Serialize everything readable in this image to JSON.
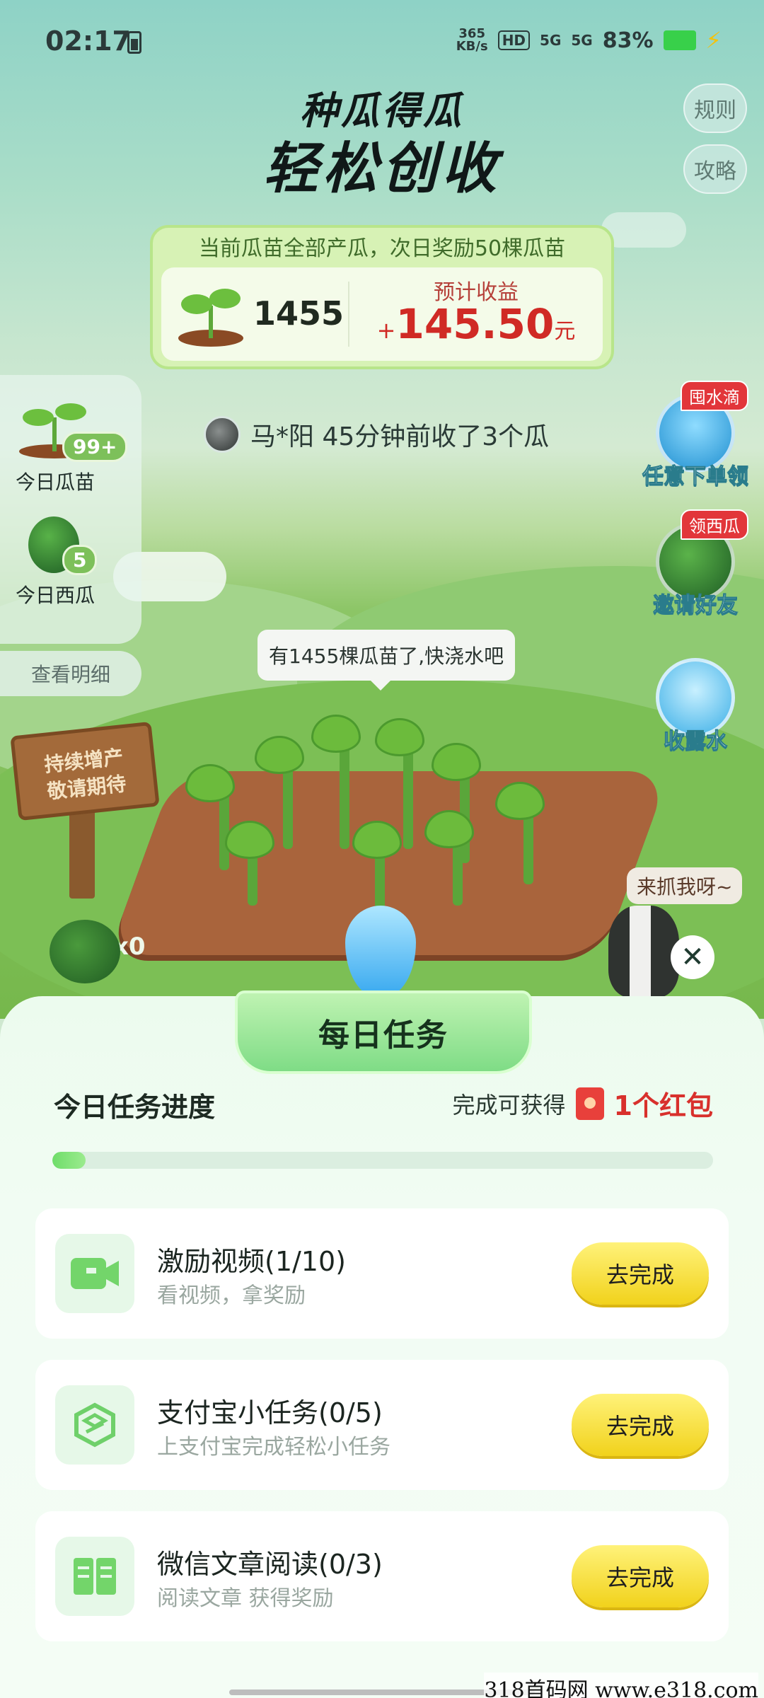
{
  "status": {
    "time": "02:17",
    "speed": "365\nKB/s",
    "hd": "HD",
    "net1": "5G",
    "net2": "5G",
    "battery": "83%"
  },
  "header": {
    "title_line1": "种瓜得瓜",
    "title_line2": "轻松创收"
  },
  "side_buttons": {
    "rules": "规则",
    "guide": "攻略"
  },
  "summary_card": {
    "headline": "当前瓜苗全部产瓜，次日奖励50棵瓜苗",
    "seedling_count": "1455",
    "estimate_label": "预计收益",
    "estimate_sign": "+",
    "estimate_value": "145.50",
    "estimate_unit": "元"
  },
  "left_panel": {
    "seedlings_badge": "99+",
    "seedlings_label": "今日瓜苗",
    "melons_badge": "5",
    "melons_label": "今日西瓜",
    "detail_button": "查看明细"
  },
  "ticker": {
    "text": "马*阳  45分钟前收了3个瓜"
  },
  "right_actions": [
    {
      "tag": "囤水滴",
      "label": "任意下单领"
    },
    {
      "tag": "领西瓜",
      "label": "邀请好友"
    },
    {
      "label": "收露水"
    }
  ],
  "farm": {
    "bubble": "有1455棵瓜苗了,快浇水吧",
    "sign_line1": "持续增产",
    "sign_line2": "敬请期待",
    "badger_speech": "来抓我呀~",
    "melon_count": "x0"
  },
  "tasks_sheet": {
    "tab_title": "每日任务",
    "progress_title": "今日任务进度",
    "reward_prefix": "完成可获得",
    "reward": "1个红包",
    "progress": 0.05,
    "items": [
      {
        "name": "激励视频(1/10)",
        "desc": "看视频，拿奖励",
        "button": "去完成",
        "icon": "video-icon"
      },
      {
        "name": "支付宝小任务(0/5)",
        "desc": "上支付宝完成轻松小任务",
        "button": "去完成",
        "icon": "alipay-icon"
      },
      {
        "name": "微信文章阅读(0/3)",
        "desc": "阅读文章 获得奖励",
        "button": "去完成",
        "icon": "book-icon"
      }
    ]
  },
  "watermark": "318首码网 www.e318.com"
}
